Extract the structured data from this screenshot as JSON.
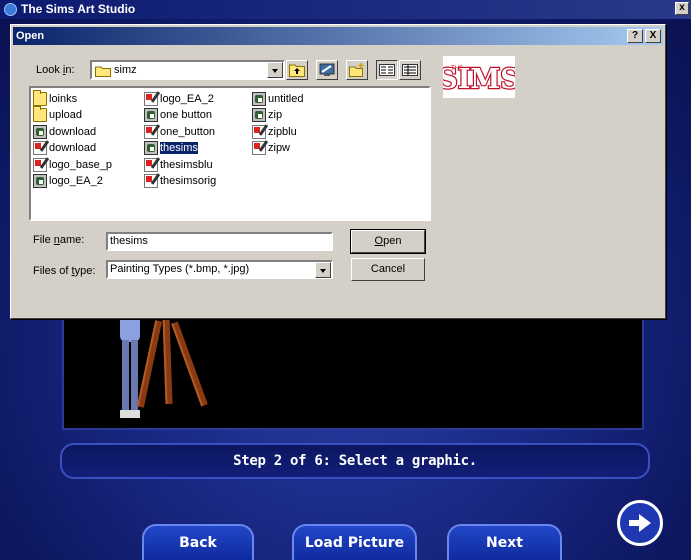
{
  "app": {
    "title": "The Sims Art Studio",
    "close_label": "x",
    "step_text": "Step 2 of 6: Select a graphic.",
    "buttons": {
      "back": "Back",
      "load_picture": "Load Picture",
      "next": "Next"
    }
  },
  "dialog": {
    "title": "Open",
    "help_label": "?",
    "close_label": "X",
    "look_in_label_pre": "Look ",
    "look_in_label_key": "i",
    "look_in_label_post": "n:",
    "look_in_value": "simz",
    "toolbar_icons": [
      "up-one-level-icon",
      "desktop-icon",
      "new-folder-icon",
      "list-view-icon",
      "details-view-icon"
    ],
    "files": [
      {
        "name": "loinks",
        "type": "folder"
      },
      {
        "name": "upload",
        "type": "folder"
      },
      {
        "name": "download",
        "type": "app"
      },
      {
        "name": "download",
        "type": "paint"
      },
      {
        "name": "logo_base_p",
        "type": "paint"
      },
      {
        "name": "logo_EA_2",
        "type": "app"
      },
      {
        "name": "logo_EA_2",
        "type": "paint"
      },
      {
        "name": "one button",
        "type": "app"
      },
      {
        "name": "one_button",
        "type": "paint"
      },
      {
        "name": "thesims",
        "type": "app",
        "selected": true
      },
      {
        "name": "thesimsblu",
        "type": "paint"
      },
      {
        "name": "thesimsorig",
        "type": "paint"
      },
      {
        "name": "untitled",
        "type": "app"
      },
      {
        "name": "zip",
        "type": "app"
      },
      {
        "name": "zipblu",
        "type": "paint"
      },
      {
        "name": "zipw",
        "type": "paint"
      }
    ],
    "file_name_label_pre": "File ",
    "file_name_label_key": "n",
    "file_name_label_post": "ame:",
    "file_name_value": "thesims",
    "files_of_type_label_pre": "Files of ",
    "files_of_type_label_key": "t",
    "files_of_type_label_post": "ype:",
    "files_of_type_value": "Painting Types (*.bmp, *.jpg)",
    "open_label_key": "O",
    "open_label_post": "pen",
    "cancel_label": "Cancel"
  },
  "colors": {
    "dialog_face": "#d4d0c8",
    "title_active": "#0a246a",
    "sims_blue": "#1a2a86"
  }
}
